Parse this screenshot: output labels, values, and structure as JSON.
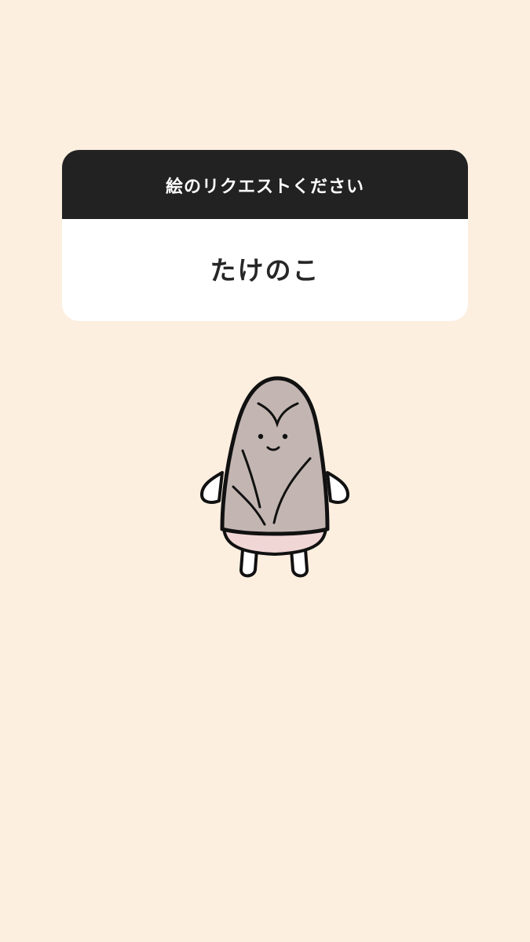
{
  "question": {
    "title": "絵のリクエストください",
    "answer": "たけのこ"
  },
  "illustration": {
    "subject": "bamboo-shoot-character",
    "colors": {
      "background": "#fdefe0",
      "body": "#c3b6b2",
      "band": "#f0d6d4",
      "outline": "#111111"
    }
  }
}
